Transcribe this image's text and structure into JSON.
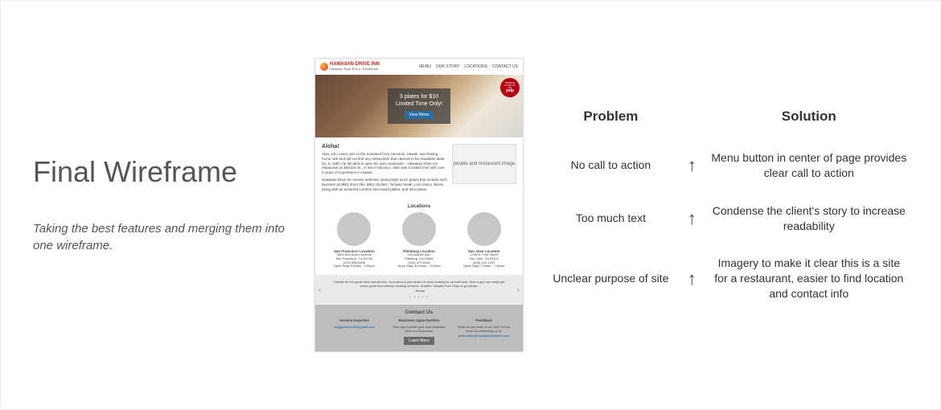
{
  "left": {
    "title": "Final Wireframe",
    "subtitle": "Taking the best features and merging them into one wireframe."
  },
  "table": {
    "head_problem": "Problem",
    "head_solution": "Solution",
    "rows": [
      {
        "problem": "No call to action",
        "solution": "Menu button in center of page provides clear call to action"
      },
      {
        "problem": "Too much text",
        "solution": "Condense the client's story to increase readability"
      },
      {
        "problem": "Unclear purpose of site",
        "solution": "Imagery to make it clear this is a site for a restaurant, easier to find location and contact info"
      }
    ]
  },
  "wf": {
    "logo": "HAWAIIAN DRIVE INN",
    "logo_sub": "Hawaiian Style B.B.Q. Restaurant",
    "nav": [
      "MENU",
      "OUR STORY",
      "LOCATIONS",
      "CONTACT US"
    ],
    "badge_top": "PEOPLE LOVE US ON",
    "badge_bottom": "yelp",
    "hero_line1": "3 plates for $10",
    "hero_line2": "Limited Time Only!",
    "hero_btn": "View Menu",
    "aloha_heading": "Aloha!",
    "aloha_p1": "Alan, who came over to the mainland from Honolulu, Hawaii, was feeling home sick and did not find any restaurants that catered to his Hawaiian taste. So, in 1987, he decided to open his own restaurant – Hawaiian Drive Inn restaurant on Mission St., in San Francisco. Alan was a skilled chef with over 6 years of experience in Hawaii.",
    "aloha_p2": "Hawaiian Drive Inn serves authentic island-style lunch plates that include such favorites as BBQ short ribs, BBQ chicken, Teriyaki Steak, Loco Moco, Bento, along with an assorted combos and mixed plates, and mini plates.",
    "aloha_img": "people and restaurant image",
    "locations_heading": "Locations",
    "locations": [
      {
        "name": "San Francisco Location",
        "addr1": "2600 San Bruno Avenue",
        "addr2": "San Francisco, CA 94134",
        "phone": "(415) 656-0698",
        "hours": "Open Daily 9:30am - 9:00pm"
      },
      {
        "name": "Pittsburg Location",
        "addr1": "149 Atlantic Ave.",
        "addr2": "Pittsburg, CA 94565",
        "phone": "(925) 473-9446",
        "hours": "Open Daily 10:30am - 9:00pm"
      },
      {
        "name": "San Jose Location",
        "addr1": "1705 N. First Street",
        "addr2": "San Jose, CA 95112",
        "phone": "(408) 441-1333",
        "hours": "Open Daily 7:00am - 7:00pm"
      }
    ],
    "quote": "Thanks for the great food and service. Your store is just what I've been looking for around here. Now a guy can really get some great food without cooking at home. Another Teriyaki Pork Chop to go please",
    "quote_author": "- Jimmy",
    "contact_heading": "Contact Us",
    "contact_cols": [
      {
        "h": "General Inquiries",
        "body": "",
        "link": "maggiechou128@gmail.com"
      },
      {
        "h": "Business Opportunities",
        "body": "Own and operate your own Hawaiian Drive Inn restaurant.",
        "link": ""
      },
      {
        "h": "Feedback",
        "body": "What do you think of our site? Let us know by contacting us at:",
        "link": "webmaster@HawaiianDriveInn.com"
      }
    ],
    "learn_more": "Learn More"
  }
}
